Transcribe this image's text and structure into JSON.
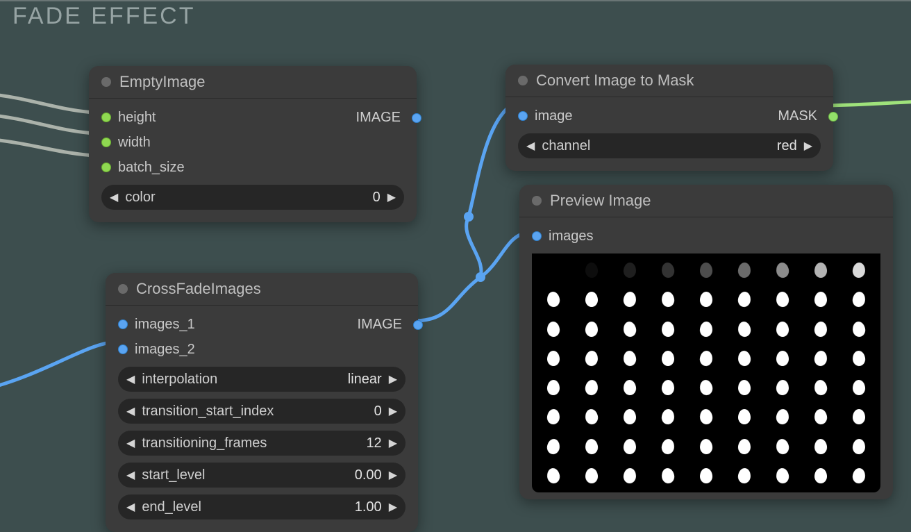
{
  "group": {
    "title": "FADE EFFECT"
  },
  "nodes": {
    "empty": {
      "title": "EmptyImage",
      "inputs": [
        "height",
        "width",
        "batch_size"
      ],
      "output": "IMAGE",
      "widgets": {
        "color": {
          "label": "color",
          "value": "0"
        }
      }
    },
    "cross": {
      "title": "CrossFadeImages",
      "inputs": [
        "images_1",
        "images_2"
      ],
      "output": "IMAGE",
      "widgets": {
        "interpolation": {
          "label": "interpolation",
          "value": "linear"
        },
        "transition_start_index": {
          "label": "transition_start_index",
          "value": "0"
        },
        "transitioning_frames": {
          "label": "transitioning_frames",
          "value": "12"
        },
        "start_level": {
          "label": "start_level",
          "value": "0.00"
        },
        "end_level": {
          "label": "end_level",
          "value": "1.00"
        }
      }
    },
    "mask": {
      "title": "Convert Image to Mask",
      "inputs": [
        "image"
      ],
      "output": "MASK",
      "widgets": {
        "channel": {
          "label": "channel",
          "value": "red"
        }
      }
    },
    "preview": {
      "title": "Preview Image",
      "inputs": [
        "images"
      ],
      "grid": {
        "rows": 8,
        "cols": 9
      },
      "fade_first_row_opacity": [
        0.0,
        0.05,
        0.12,
        0.2,
        0.3,
        0.42,
        0.55,
        0.7,
        0.85
      ]
    }
  },
  "wires": {
    "desc": "blue: CrossFadeImages.IMAGE -> ConvertImageToMask.image & PreviewImage.images; grey: external -> EmptyImage.height/width/batch_size; lime: ConvertImageToMask.MASK -> offscreen"
  }
}
